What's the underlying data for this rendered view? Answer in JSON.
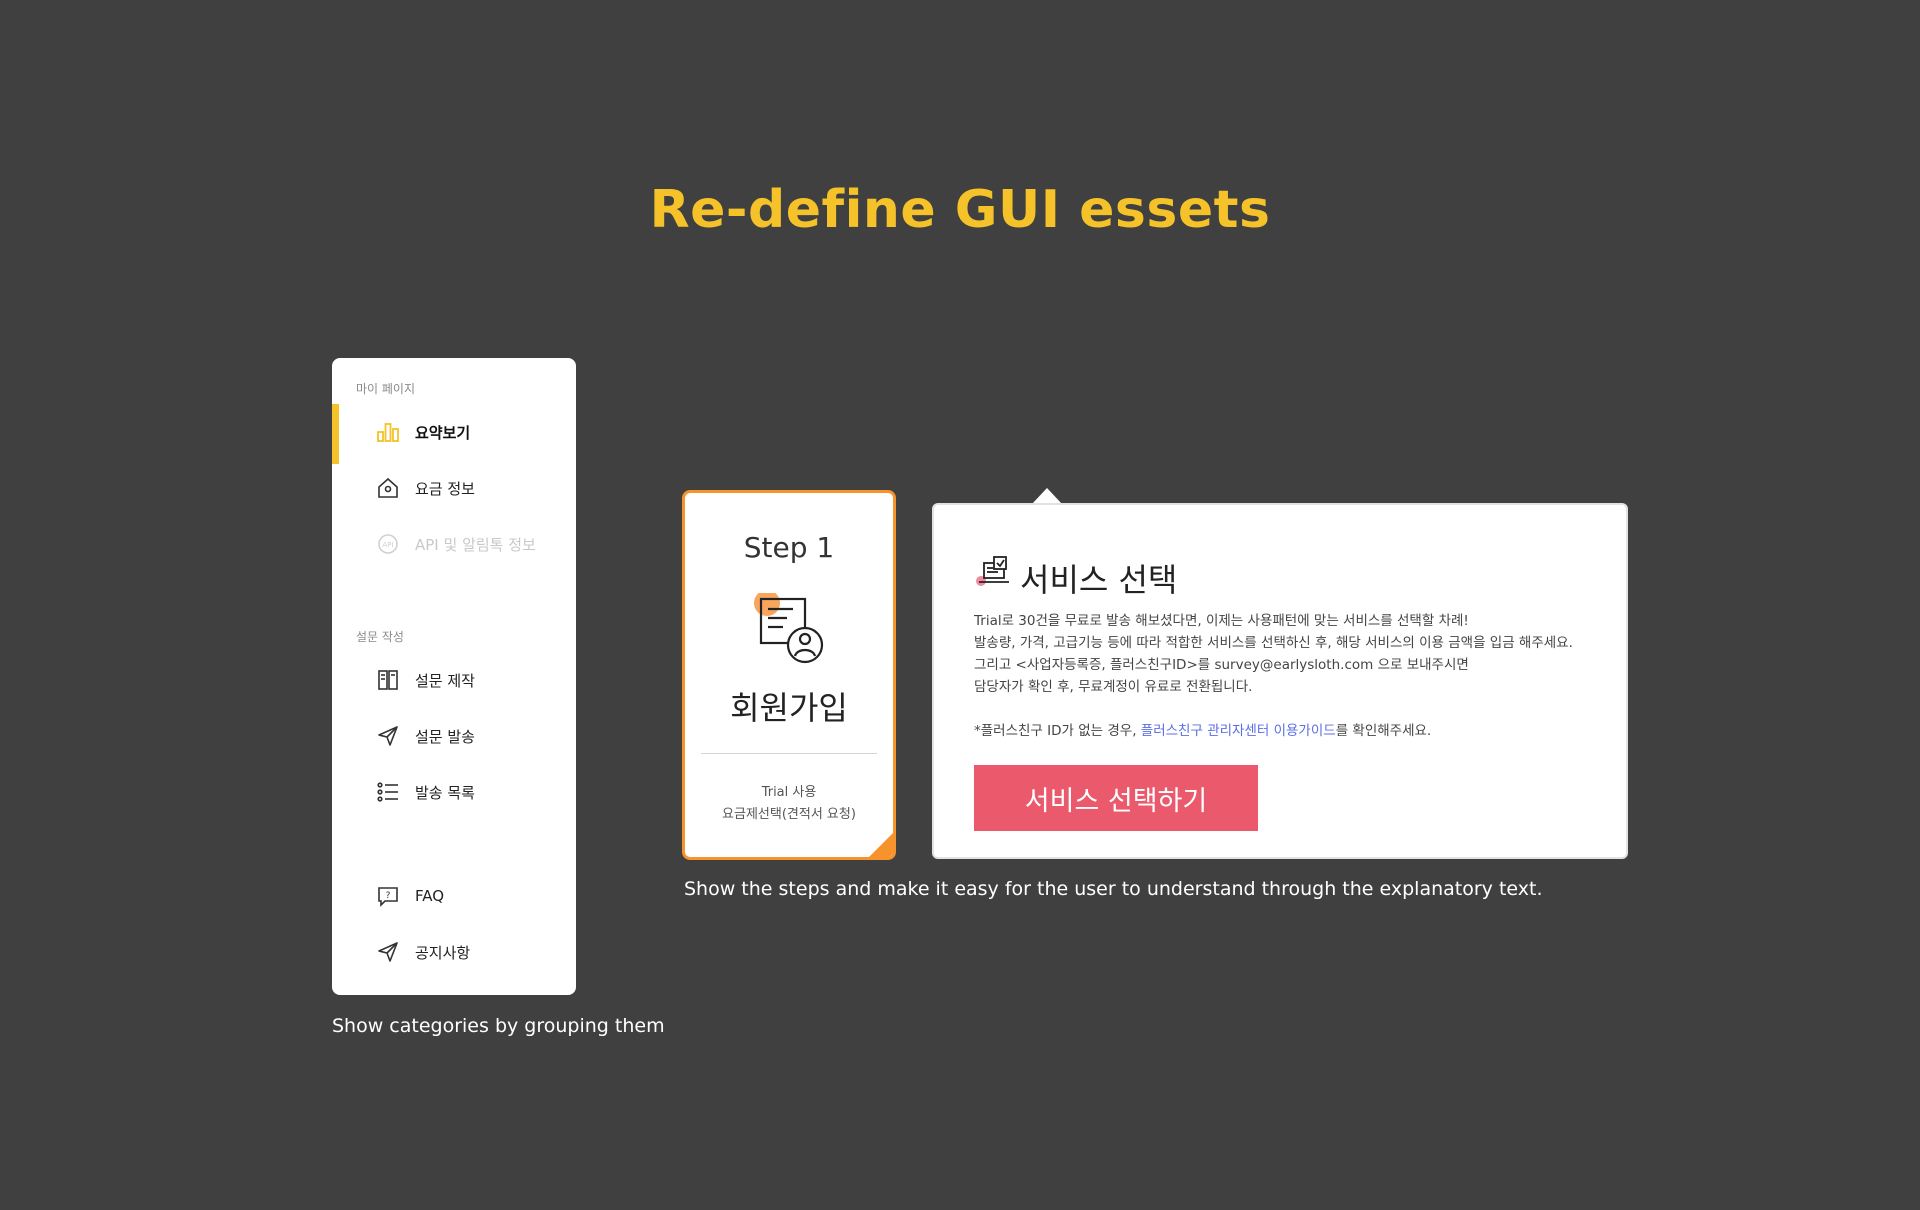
{
  "title": "Re-define GUI essets",
  "sidebar": {
    "section_mypage": "마이 페이지",
    "section_survey": "설문 작성",
    "items": [
      {
        "label": "요약보기",
        "icon": "bar-chart-icon"
      },
      {
        "label": "요금 정보",
        "icon": "house-icon"
      },
      {
        "label": "API 및 알림톡 정보",
        "icon": "api-icon"
      },
      {
        "label": "설문 제작",
        "icon": "survey-edit-icon"
      },
      {
        "label": "설문 발송",
        "icon": "send-icon"
      },
      {
        "label": "발송 목록",
        "icon": "list-icon"
      },
      {
        "label": "FAQ",
        "icon": "faq-icon"
      },
      {
        "label": "공지사항",
        "icon": "send-icon"
      }
    ],
    "accent_color": "#f5c22a"
  },
  "caption_sidebar": "Show categories by grouping them",
  "step_card": {
    "step_label": "Step 1",
    "title": "회원가입",
    "sub_line1": "Trial 사용",
    "sub_line2": "요금제선택(견적서 요청)",
    "border_color": "#f7932c"
  },
  "service_panel": {
    "title": "서비스 선택",
    "line1": "Trial로 30건을 무료로 발송 해보셨다면, 이제는 사용패턴에 맞는 서비스를 선택할 차례!",
    "line2": "발송량, 가격, 고급기능 등에 따라 적합한 서비스를 선택하신 후, 해당 서비스의 이용 금액을 입금 해주세요.",
    "line3": "그리고 <사업자등록증, 플러스친구ID>를 survey@earlysloth.com 으로 보내주시면",
    "line4": "담당자가 확인 후, 무료계정이 유료로 전환됩니다.",
    "note_prefix": "*플러스친구 ID가 없는 경우, ",
    "note_link": "플러스친구 관리자센터 이용가이드",
    "note_suffix": "를 확인해주세요.",
    "button_label": "서비스 선택하기",
    "button_color": "#ea5a6c"
  },
  "caption_steps": "Show the steps and make it easy for the user to understand through the explanatory text."
}
